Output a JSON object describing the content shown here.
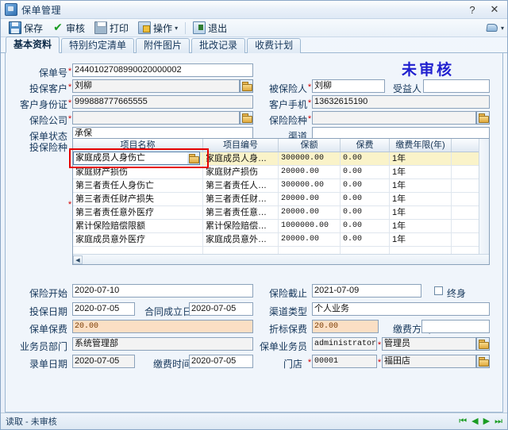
{
  "window": {
    "title": "保单管理",
    "help_btn": "?",
    "close_btn": "✕"
  },
  "toolbar": {
    "items": [
      {
        "label": "保存",
        "icon": "save-icon"
      },
      {
        "label": "审核",
        "icon": "check-icon"
      },
      {
        "label": "打印",
        "icon": "print-icon"
      },
      {
        "label": "操作",
        "icon": "operation-icon",
        "caret": "▾"
      },
      {
        "label": "退出",
        "icon": "exit-icon"
      }
    ],
    "help_icon": "help-balloon-icon"
  },
  "tabs": [
    {
      "label": "基本资料",
      "active": true
    },
    {
      "label": "特别约定清单",
      "active": false
    },
    {
      "label": "附件图片",
      "active": false
    },
    {
      "label": "批改记录",
      "active": false
    },
    {
      "label": "收费计划",
      "active": false
    }
  ],
  "stamp": "未审核",
  "form": {
    "policy_no_label": "保单号",
    "policy_no_value": "2440102708990020000002",
    "applicant_label": "投保客户",
    "applicant_value": "刘柳",
    "insured_label": "被保险人",
    "insured_value": "刘柳",
    "beneficiary_label": "受益人",
    "beneficiary_value": "",
    "id_label": "客户身份证",
    "id_value": "999888777665555",
    "mobile_label": "客户手机",
    "mobile_value": "13632615190",
    "company_label": "保险公司",
    "company_value": "",
    "insurance_type_label": "保险险种",
    "insurance_type_value": "",
    "status_label": "保单状态",
    "status_value": "承保",
    "channel_label": "渠道",
    "channel_value": "",
    "coverage_label": "投保险种",
    "start_label": "保险开始",
    "start_value": "2020-07-10",
    "end_label": "保险截止",
    "end_value": "2021-07-09",
    "lifetime_label": "终身",
    "lifetime_checked": false,
    "apply_date_label": "投保日期",
    "apply_date_value": "2020-07-05",
    "contract_date_label": "合同成立日期",
    "contract_date_value": "2020-07-05",
    "channel_type_label": "渠道类型",
    "channel_type_value": "个人业务",
    "premium_label": "保单保费",
    "premium_value": "20.00",
    "std_premium_label": "折标保费",
    "std_premium_value": "20.00",
    "pay_mode_label": "缴费方式",
    "pay_mode_value": "",
    "dept_label": "业务员部门",
    "dept_value": "系统管理部",
    "agent_label": "保单业务员",
    "agent_code": "administrator",
    "agent_name": "管理员",
    "entry_date_label": "录单日期",
    "entry_date_value": "2020-07-05",
    "pay_time_label": "缴费时间",
    "pay_time_value": "2020-07-05",
    "store_label": "门店",
    "store_code": "00001",
    "store_name": "福田店"
  },
  "grid": {
    "columns": [
      "项目名称",
      "项目编号",
      "保额",
      "保费",
      "缴费年限(年)",
      ""
    ],
    "rows": [
      {
        "name": "家庭成员人身伤亡",
        "code": "家庭成员人身…",
        "amount": "300000.00",
        "fee": "0.00",
        "years": "1年",
        "extra": "",
        "selected": true,
        "editing": true
      },
      {
        "name": "家庭财产损伤",
        "code": "家庭财产损伤",
        "amount": "20000.00",
        "fee": "0.00",
        "years": "1年",
        "extra": "",
        "selected": false
      },
      {
        "name": "第三者责任人身伤亡",
        "code": "第三者责任人…",
        "amount": "300000.00",
        "fee": "0.00",
        "years": "1年",
        "extra": "",
        "selected": false
      },
      {
        "name": "第三者责任财产损失",
        "code": "第三者责任财…",
        "amount": "20000.00",
        "fee": "0.00",
        "years": "1年",
        "extra": "",
        "selected": false
      },
      {
        "name": "第三者责任意外医疗",
        "code": "第三者责任意…",
        "amount": "20000.00",
        "fee": "0.00",
        "years": "1年",
        "extra": "",
        "selected": false
      },
      {
        "name": "累计保险赔偿限额",
        "code": "累计保险赔偿…",
        "amount": "1000000.00",
        "fee": "0.00",
        "years": "1年",
        "extra": "",
        "selected": false
      },
      {
        "name": "家庭成员意外医疗",
        "code": "家庭成员意外…",
        "amount": "20000.00",
        "fee": "0.00",
        "years": "1年",
        "extra": "",
        "selected": false
      },
      {
        "name": "",
        "code": "",
        "amount": "",
        "fee": "",
        "years": "",
        "extra": "",
        "selected": false
      }
    ]
  },
  "statusbar": {
    "text": "读取 - 未审核",
    "nav": [
      "⏮",
      "◀",
      "▶",
      "⏭"
    ]
  },
  "colors": {
    "stamp": "#2020cf",
    "required": "#d40000",
    "money_bg": "#fbdfc4",
    "selected_row": "#faf3c9",
    "highlight_box": "#e60000"
  }
}
